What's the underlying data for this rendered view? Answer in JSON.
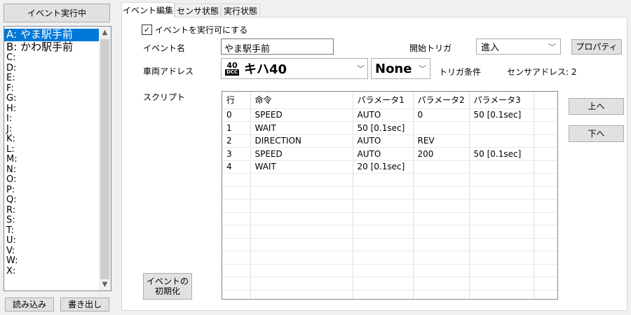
{
  "left": {
    "running_button": "イベント実行中",
    "items": [
      {
        "label": "A: やま駅手前",
        "selected": true,
        "big": true
      },
      {
        "label": "B: かわ駅手前",
        "big": true
      },
      {
        "label": "C:"
      },
      {
        "label": "D:"
      },
      {
        "label": "E:"
      },
      {
        "label": "F:"
      },
      {
        "label": "G:"
      },
      {
        "label": "H:"
      },
      {
        "label": "I:"
      },
      {
        "label": "J:"
      },
      {
        "label": "K:"
      },
      {
        "label": "L:"
      },
      {
        "label": "M:"
      },
      {
        "label": "N:"
      },
      {
        "label": "O:"
      },
      {
        "label": "P:"
      },
      {
        "label": "Q:"
      },
      {
        "label": "R:"
      },
      {
        "label": "S:"
      },
      {
        "label": "T:"
      },
      {
        "label": "U:"
      },
      {
        "label": "V:"
      },
      {
        "label": "W:"
      },
      {
        "label": "X:"
      }
    ],
    "load_button": "読み込み",
    "save_button": "書き出し"
  },
  "tabs": [
    {
      "label": "イベント編集",
      "active": true
    },
    {
      "label": "センサ状態"
    },
    {
      "label": "実行状態"
    }
  ],
  "editor": {
    "enable_checkbox_label": "イベントを実行可にする",
    "enable_checked": true,
    "event_name_label": "イベント名",
    "event_name_value": "やま駅手前",
    "start_trigger_label": "開始トリガ",
    "start_trigger_value": "進入",
    "property_button": "プロパティ",
    "vehicle_address_label": "車両アドレス",
    "loco_badge_top": "40",
    "loco_badge_bottom": "DCC",
    "vehicle_value": "キハ40",
    "trigger_select_value": "None",
    "trigger_condition_label": "トリガ条件",
    "sensor_address_label": "センサアドレス: 2",
    "script_label": "スクリプト",
    "up_button": "上へ",
    "down_button": "下へ",
    "init_button_line1": "イベントの",
    "init_button_line2": "初期化"
  },
  "script": {
    "columns": [
      "行",
      "命令",
      "パラメータ1",
      "パラメータ2",
      "パラメータ3"
    ],
    "rows": [
      [
        "0",
        "SPEED",
        "AUTO",
        "0",
        "50 [0.1sec]"
      ],
      [
        "1",
        "WAIT",
        "50 [0.1sec]",
        "",
        ""
      ],
      [
        "2",
        "DIRECTION",
        "AUTO",
        "REV",
        ""
      ],
      [
        "3",
        "SPEED",
        "AUTO",
        "200",
        "50 [0.1sec]"
      ],
      [
        "4",
        "WAIT",
        "20 [0.1sec]",
        "",
        ""
      ]
    ]
  },
  "colors": {
    "selection": "#0078d7",
    "panel_bg": "#ffffff",
    "window_bg": "#f0f0f0"
  }
}
